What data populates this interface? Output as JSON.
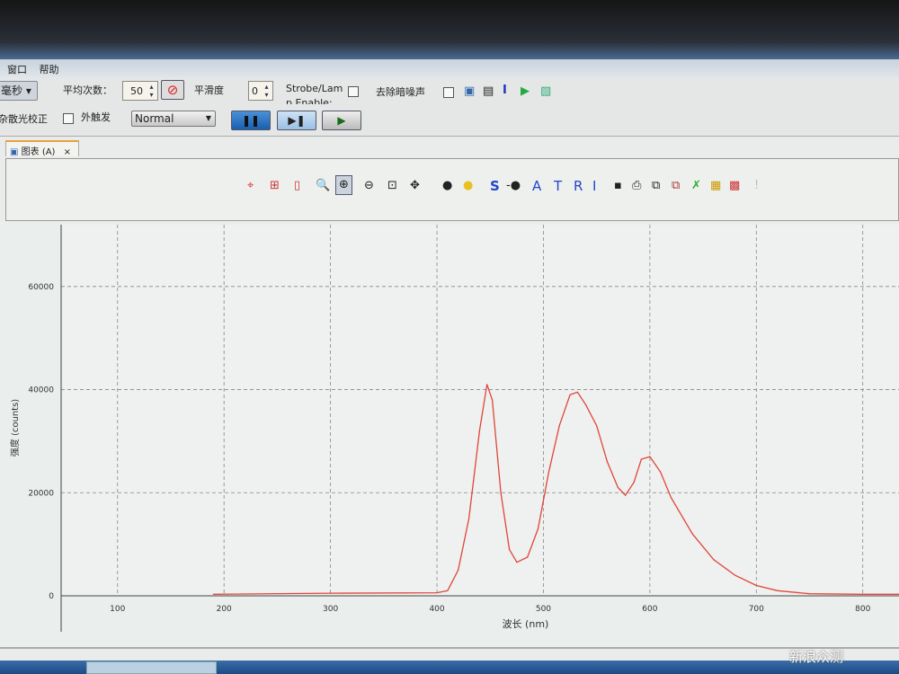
{
  "menu": {
    "items": [
      "窗口",
      "帮助"
    ]
  },
  "toolbar": {
    "unit_select": "毫秒",
    "avg_label": "平均次数：",
    "avg_value": "50",
    "smooth_label": "平滑度",
    "smooth_value": "0",
    "strobe_label": "Strobe/Lam",
    "strobe_label2": "p Enable:",
    "dark_noise_label": "去除暗噪声",
    "stray_light_label": "杂散光校正",
    "ext_trigger_label": "外触发",
    "trigger_mode": "Normal"
  },
  "tab": {
    "label": "图表 (A)",
    "close": "×"
  },
  "chart_toolbar": {
    "letters": [
      "S",
      "A",
      "T",
      "R",
      "I"
    ]
  },
  "chart_data": {
    "type": "line",
    "xlabel": "波长 (nm)",
    "ylabel": "强度 (counts)",
    "xlim": [
      47,
      834
    ],
    "ylim": [
      0,
      72000
    ],
    "xticks": [
      100,
      200,
      300,
      400,
      500,
      600,
      700,
      800
    ],
    "yticks": [
      0,
      20000,
      40000,
      60000
    ],
    "grid": true,
    "color": "#e0453a",
    "x": [
      190,
      300,
      400,
      410,
      420,
      430,
      440,
      447,
      452,
      460,
      468,
      475,
      485,
      495,
      505,
      515,
      525,
      532,
      540,
      550,
      560,
      570,
      577,
      585,
      592,
      600,
      610,
      620,
      640,
      660,
      680,
      700,
      720,
      750,
      800,
      834
    ],
    "y": [
      300,
      500,
      600,
      1000,
      5000,
      15000,
      32000,
      41000,
      38000,
      20000,
      9000,
      6500,
      7500,
      13000,
      24000,
      33000,
      39000,
      39500,
      37000,
      33000,
      26000,
      21000,
      19500,
      22000,
      26500,
      27000,
      24000,
      19000,
      12000,
      7000,
      4000,
      2000,
      1000,
      400,
      300,
      300
    ]
  },
  "watermark": "新浪众测"
}
